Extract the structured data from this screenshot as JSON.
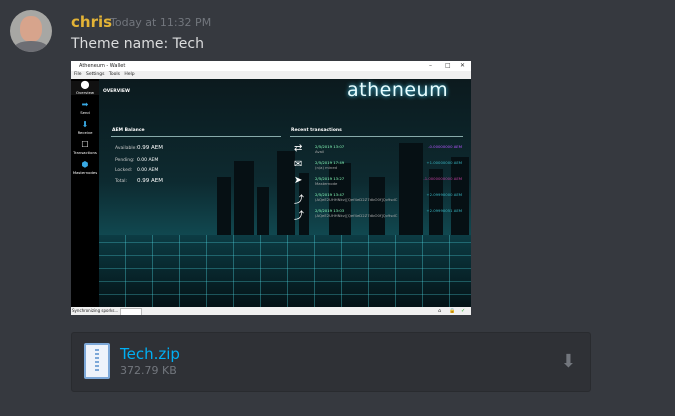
{
  "message": {
    "username": "chris",
    "timestamp": "Today at 11:32 PM",
    "text": "Theme name: Tech"
  },
  "screenshot": {
    "window_title": "Atheneum - Wallet",
    "window_controls": [
      "–",
      "□",
      "✕"
    ],
    "menu": [
      "File",
      "Settings",
      "Tools",
      "Help"
    ],
    "sidebar": [
      {
        "label": "Overview",
        "icon": "overview-icon",
        "glyph": "⬤"
      },
      {
        "label": "Send",
        "icon": "send-arrow-icon",
        "glyph": "➡"
      },
      {
        "label": "Receive",
        "icon": "receive-arrow-icon",
        "glyph": "⬇"
      },
      {
        "label": "Transactions",
        "icon": "transactions-icon",
        "glyph": "☐"
      },
      {
        "label": "Masternodes",
        "icon": "masternodes-icon",
        "glyph": "⬢"
      }
    ],
    "page_title": "OVERVIEW",
    "logo": "atheneum",
    "balance": {
      "title": "AEM Balance",
      "rows": [
        {
          "label": "Available:",
          "value": "0.99 AEM"
        },
        {
          "label": "Pending:",
          "value": "0.00 AEM"
        },
        {
          "label": "Locked:",
          "value": "0.00 AEM"
        },
        {
          "label": "Total:",
          "value": "0.99 AEM"
        }
      ]
    },
    "recent": {
      "title": "Recent transactions",
      "items": [
        {
          "date": "2/5/2019 13:07",
          "addr": "Avail",
          "amount": "-0.00000000 AEM",
          "color": "#b455ff",
          "icon": "transfer-icon",
          "glyph": "⇄"
        },
        {
          "date": "2/5/2019 17:49",
          "addr": "(n/a) mined",
          "amount": "+1.00000000 AEM",
          "color": "#39b7c4",
          "icon": "mined-icon",
          "glyph": "✉"
        },
        {
          "date": "2/5/2019 13:27",
          "addr": "Masternode",
          "amount": "-1.0000000000 AEM",
          "color": "#c23fa0",
          "icon": "sent-icon",
          "glyph": "➤"
        },
        {
          "date": "2/5/2019 13:47",
          "addr": "(AQeE2UHHNkv)[Qef4eD2Z7dbO0f]Qv9sdC",
          "amount": "+2.09990000 AEM",
          "color": "#39b7c4",
          "icon": "received-icon",
          "glyph": "⤴"
        },
        {
          "date": "2/5/2019 13:03",
          "addr": "(AQeE2UHHNkv)[Qef4eD2Z7dbO0f]Qv9sdC",
          "amount": "+2.09990051 AEM",
          "color": "#39b7c4",
          "icon": "received-icon",
          "glyph": "⤴"
        }
      ]
    },
    "status": {
      "text": "Synchronizing sporks...",
      "icons": [
        "⌂",
        "🔒",
        "✓"
      ]
    }
  },
  "attachment": {
    "filename": "Tech.zip",
    "size": "372.79 KB",
    "download_glyph": "⬇"
  }
}
